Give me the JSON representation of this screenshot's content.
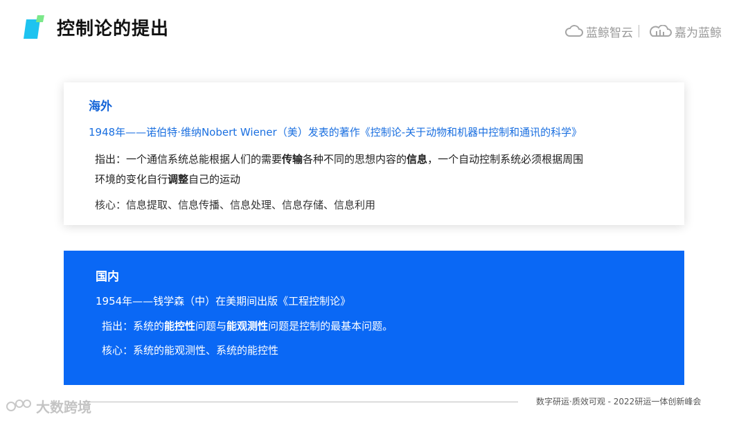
{
  "header": {
    "title": "控制论的提出",
    "brand_left": "蓝鲸智云",
    "brand_right": "嘉为蓝鲸",
    "accent_color": "#1ec3f0"
  },
  "overseas": {
    "heading": "海外",
    "event": "1948年——诺伯特·维纳Nobert Wiener（美）发表的著作《控制论-关于动物和机器中控制和通讯的科学》",
    "point_prefix": "指出：一个通信系统总能根据人们的需要",
    "point_bold1": "传输",
    "point_mid": "各种不同的思想内容的",
    "point_bold2": "信息",
    "point_tail": "，一个自动控制系统必须根据周围",
    "point2_prefix": "环境的变化自行",
    "point2_bold": "调整",
    "point2_tail": "自己的运动",
    "core": "核心：信息提取、信息传播、信息处理、信息存储、信息利用"
  },
  "domestic": {
    "heading": "国内",
    "event": "1954年——钱学森（中）在美期间出版《工程控制论》",
    "point_prefix": "指出：系统的",
    "point_bold1": "能控性",
    "point_mid": "问题与",
    "point_bold2": "能观测性",
    "point_tail": "问题是控制的最基本问题。",
    "core": "核心：系统的能观测性、系统的能控性",
    "background_color": "#0a68f5"
  },
  "footer": {
    "text": "数字研运·质效可观  -  2022研运一体创新峰会",
    "watermark": "大数跨境"
  }
}
